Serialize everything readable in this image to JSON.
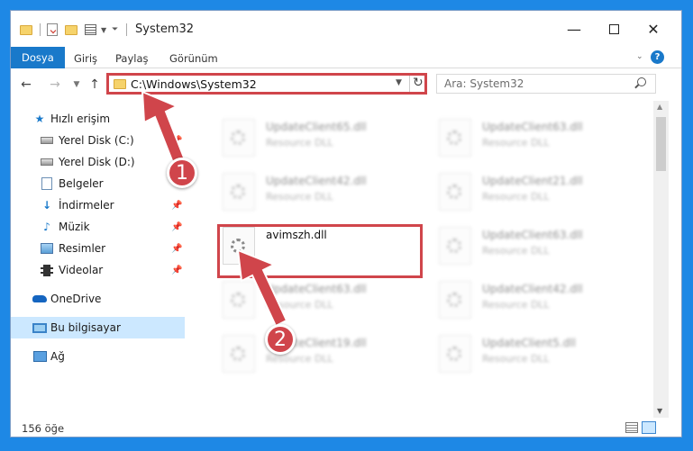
{
  "window": {
    "title": "System32",
    "controls": {
      "minimize": "—",
      "close": "✕"
    }
  },
  "ribbon": {
    "tabs": [
      "Dosya",
      "Giriş",
      "Paylaş",
      "Görünüm"
    ]
  },
  "nav": {
    "back": "←",
    "forward": "→",
    "up": "↑",
    "refresh": "↻",
    "address": "C:\\Windows\\System32",
    "search_placeholder": "Ara: System32"
  },
  "sidebar": {
    "items": [
      {
        "label": "Hızlı erişim",
        "icon": "star-icon"
      },
      {
        "label": "Yerel Disk (C:)",
        "icon": "disk-icon"
      },
      {
        "label": "Yerel Disk (D:)",
        "icon": "disk-icon"
      },
      {
        "label": "Belgeler",
        "icon": "documents-icon"
      },
      {
        "label": "İndirmeler",
        "icon": "download-icon"
      },
      {
        "label": "Müzik",
        "icon": "music-icon"
      },
      {
        "label": "Resimler",
        "icon": "pictures-icon"
      },
      {
        "label": "Videolar",
        "icon": "videos-icon"
      },
      {
        "label": "OneDrive",
        "icon": "onedrive-icon"
      },
      {
        "label": "Bu bilgisayar",
        "icon": "computer-icon"
      },
      {
        "label": "Ağ",
        "icon": "network-icon"
      }
    ]
  },
  "files": {
    "left_column": [
      {
        "name": "UpdateClient65.dll",
        "type": "Resource DLL"
      },
      {
        "name": "UpdateClient42.dll",
        "type": "Resource DLL"
      },
      {
        "name": "avimszh.dll",
        "type": ""
      },
      {
        "name": "UpdateClient63.dll",
        "type": "Resource DLL"
      },
      {
        "name": "UpdateClient19.dll",
        "type": "Resource DLL"
      }
    ],
    "right_column": [
      {
        "name": "UpdateClient63.dll",
        "type": "Resource DLL"
      },
      {
        "name": "UpdateClient21.dll",
        "type": "Resource DLL"
      },
      {
        "name": "UpdateClient63.dll",
        "type": "Resource DLL"
      },
      {
        "name": "UpdateClient42.dll",
        "type": "Resource DLL"
      },
      {
        "name": "UpdateClient5.dll",
        "type": "Resource DLL"
      }
    ]
  },
  "status": {
    "count": "156 öğe"
  },
  "annotations": {
    "step1": "1",
    "step2": "2"
  },
  "colors": {
    "accent": "#1979ca",
    "highlight": "#d0454b",
    "selected": "#cce8ff"
  }
}
